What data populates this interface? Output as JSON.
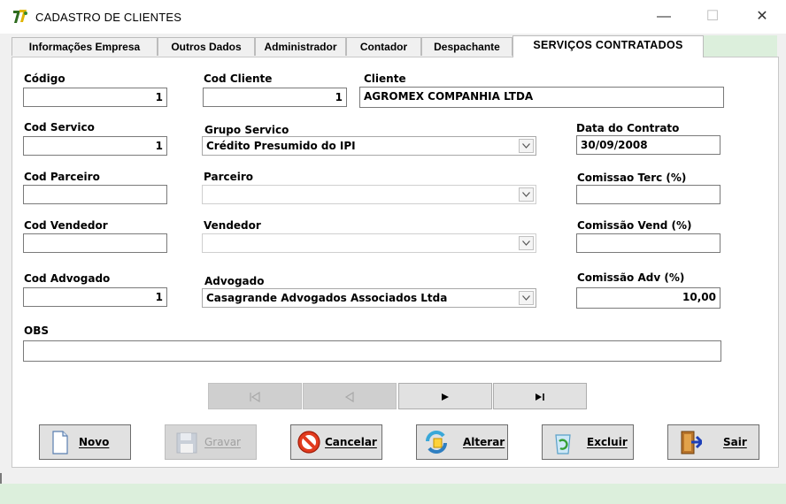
{
  "window": {
    "title": "CADASTRO DE CLIENTES",
    "minimize_glyph": "—",
    "maximize_glyph": "☐",
    "close_glyph": "✕"
  },
  "tabs": [
    {
      "label": "Informações Empresa"
    },
    {
      "label": "Outros Dados"
    },
    {
      "label": "Administrador"
    },
    {
      "label": "Contador"
    },
    {
      "label": "Despachante"
    },
    {
      "label": "SERVIÇOS CONTRATADOS",
      "active": true
    }
  ],
  "form": {
    "codigo": {
      "label": "Código",
      "value": "1"
    },
    "cod_cliente": {
      "label": "Cod Cliente",
      "value": "1"
    },
    "cliente": {
      "label": "Cliente",
      "value": "AGROMEX COMPANHIA LTDA"
    },
    "cod_servico": {
      "label": "Cod Servico",
      "value": "1"
    },
    "grupo_servico": {
      "label": "Grupo Servico",
      "value": "Crédito Presumido do IPI"
    },
    "data_contrato": {
      "label": "Data do Contrato",
      "value": "30/09/2008"
    },
    "cod_parceiro": {
      "label": "Cod Parceiro",
      "value": ""
    },
    "parceiro": {
      "label": "Parceiro",
      "value": ""
    },
    "comissao_terc": {
      "label": "Comissao Terc (%)",
      "value": ""
    },
    "cod_vendedor": {
      "label": "Cod Vendedor",
      "value": ""
    },
    "vendedor": {
      "label": "Vendedor",
      "value": ""
    },
    "comissao_vend": {
      "label": "Comissão Vend (%)",
      "value": ""
    },
    "cod_advogado": {
      "label": "Cod Advogado",
      "value": "1"
    },
    "advogado": {
      "label": "Advogado",
      "value": "Casagrande Advogados Associados Ltda"
    },
    "comissao_adv": {
      "label": "Comissão Adv (%)",
      "value": "10,00"
    },
    "obs": {
      "label": "OBS",
      "value": ""
    }
  },
  "navigator": {
    "first": "⏮",
    "prior": "◁",
    "next": "▶",
    "last": "▶|"
  },
  "actions": {
    "novo": "Novo",
    "gravar": "Gravar",
    "cancelar": "Cancelar",
    "alterar": "Alterar",
    "excluir": "Excluir",
    "sair": "Sair"
  }
}
